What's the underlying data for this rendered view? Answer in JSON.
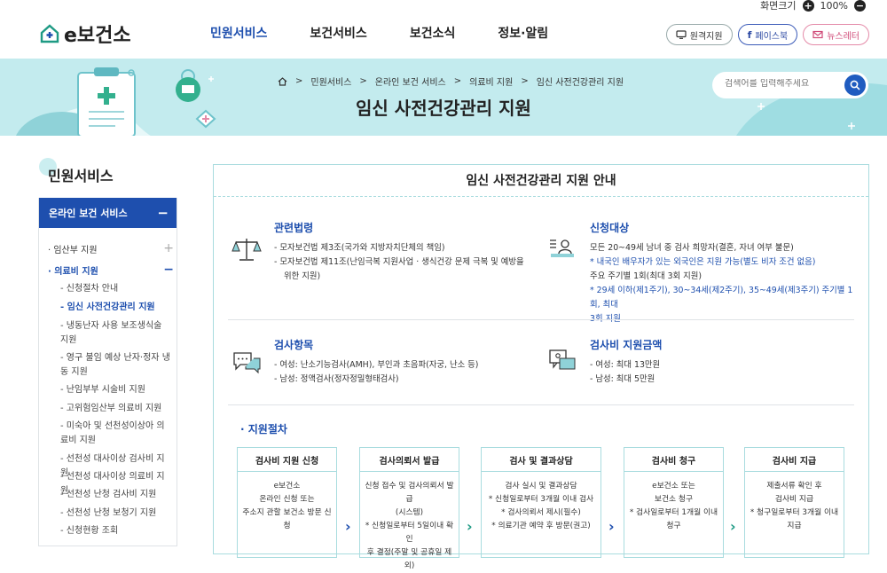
{
  "zoom": {
    "label": "화면크기",
    "value": "100%",
    "plus": "+",
    "minus": "−"
  },
  "logo": {
    "text": "e보건소"
  },
  "gnb": [
    "민원서비스",
    "보건서비스",
    "보건소식",
    "정보·알림"
  ],
  "util": {
    "remote": "원격지원",
    "facebook": "페이스북",
    "newsletter": "뉴스레터"
  },
  "breadcrumb": [
    "민원서비스",
    "온라인 보건 서비스",
    "의료비 지원",
    "임신 사전건강관리 지원"
  ],
  "page_title": "임신 사전건강관리 지원",
  "search": {
    "placeholder": "검색어를 입력해주세요"
  },
  "lnb": {
    "title": "민원서비스",
    "head": "온라인 보건 서비스",
    "items": [
      {
        "label": "임산부 지원",
        "toggle": "+"
      },
      {
        "label": "의료비 지원",
        "toggle": "−"
      }
    ],
    "subs": [
      "신청절차 안내",
      "임신 사전건강관리 지원",
      "냉동난자 사용 보조생식술 지원",
      "영구 불임 예상 난자·정자 냉동 지원",
      "난임부부 시술비 지원",
      "고위험임산부 의료비 지원",
      "미숙아 및 선천성이상아 의료비 지원",
      "선천성 대사이상 검사비 지원",
      "선천성 대사이상 의료비 지원",
      "선천성 난청 검사비 지원",
      "선천성 난청 보청기 지원",
      "신청현황 조회"
    ]
  },
  "content": {
    "title": "임신 사전건강관리 지원 안내",
    "law": {
      "title": "관련법령",
      "lines": [
        "모자보건법 제3조(국가와 지방자치단체의 책임)",
        "모자보건법 제11조(난임극복 지원사업 · 생식건강 문제 극복 및 예방을",
        "위한 지원)"
      ]
    },
    "target": {
      "title": "신청대상",
      "lines": [
        "모든 20~49세 남녀 중 검사 희망자(결혼, 자녀 여부 불문)",
        "* 내국인 배우자가 있는 외국인은 지원 가능(별도 비자 조건 없음)",
        "주요 주기별 1회(최대 3회 지원)",
        "* 29세 이하(제1주기), 30~34세(제2주기), 35~49세(제3주기) 주기별 1회, 최대",
        "3회 지원"
      ]
    },
    "items": {
      "title": "검사항목",
      "lines": [
        "여성: 난소기능검사(AMH), 부인과 초음파(자궁, 난소 등)",
        "남성: 정액검사(정자정밀형태검사)"
      ]
    },
    "amount": {
      "title": "검사비 지원금액",
      "lines": [
        "여성: 최대 13만원",
        "남성: 최대 5만원"
      ]
    },
    "procedure_title": "· 지원절차",
    "steps": [
      {
        "title": "검사비 지원 신청",
        "lines": [
          "e보건소",
          "온라인 신청 또는",
          "주소지 관할 보건소 방문 신청"
        ]
      },
      {
        "title": "검사의뢰서 발급",
        "lines": [
          "신청 접수 및 검사의뢰서 발급",
          "(시스템)",
          "* 신청일로부터 5일이내 확인",
          "후 결정(주말 및 공휴일 제외)"
        ]
      },
      {
        "title": "검사 및 결과상담",
        "lines": [
          "검사 실시 및 결과상담",
          "* 신청일로부터 3개월 이내 검사",
          "* 검사의뢰서 제시(필수)",
          "* 의료기관 예약 후 방문(권고)"
        ]
      },
      {
        "title": "검사비 청구",
        "lines": [
          "e보건소 또는",
          "보건소 청구",
          "* 검사일로부터 1개월 이내",
          "청구"
        ]
      },
      {
        "title": "검사비 지급",
        "lines": [
          "제출서류 확인 후",
          "검사비 지급",
          "* 청구일로부터 3개월 이내",
          "지급"
        ]
      }
    ]
  },
  "colors": {
    "accent": "#1e4fae",
    "banner": "#c3ebee",
    "border": "#a9dcdf",
    "newsletter": "#d04b78"
  }
}
